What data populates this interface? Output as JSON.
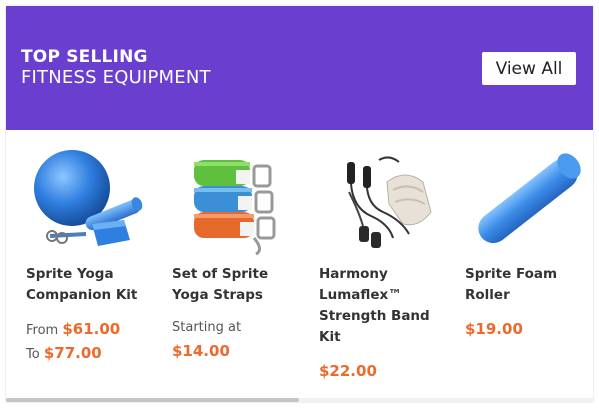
{
  "header": {
    "title": "TOP SELLING",
    "subtitle": "FITNESS EQUIPMENT",
    "view_all_label": "View All"
  },
  "products": [
    {
      "name_lines": [
        "Sprite Yoga",
        "Companion Kit"
      ],
      "price_from_prefix": "From",
      "price_from": "$61.00",
      "price_to_prefix": "To",
      "price_to": "$77.00",
      "image_icon": "yoga-kit-image"
    },
    {
      "name_lines": [
        "Set of Sprite",
        "Yoga Straps"
      ],
      "price_prefix": "Starting at",
      "price": "$14.00",
      "image_icon": "yoga-straps-image"
    },
    {
      "name_lines": [
        "Harmony",
        "Lumaflex™",
        "Strength Band",
        "Kit"
      ],
      "price": "$22.00",
      "image_icon": "strength-band-image"
    },
    {
      "name_lines": [
        "Sprite Foam",
        "Roller"
      ],
      "price": "$19.00",
      "image_icon": "foam-roller-image"
    }
  ],
  "colors": {
    "header_bg": "#6a3fcf",
    "price": "#ee6a2c"
  }
}
